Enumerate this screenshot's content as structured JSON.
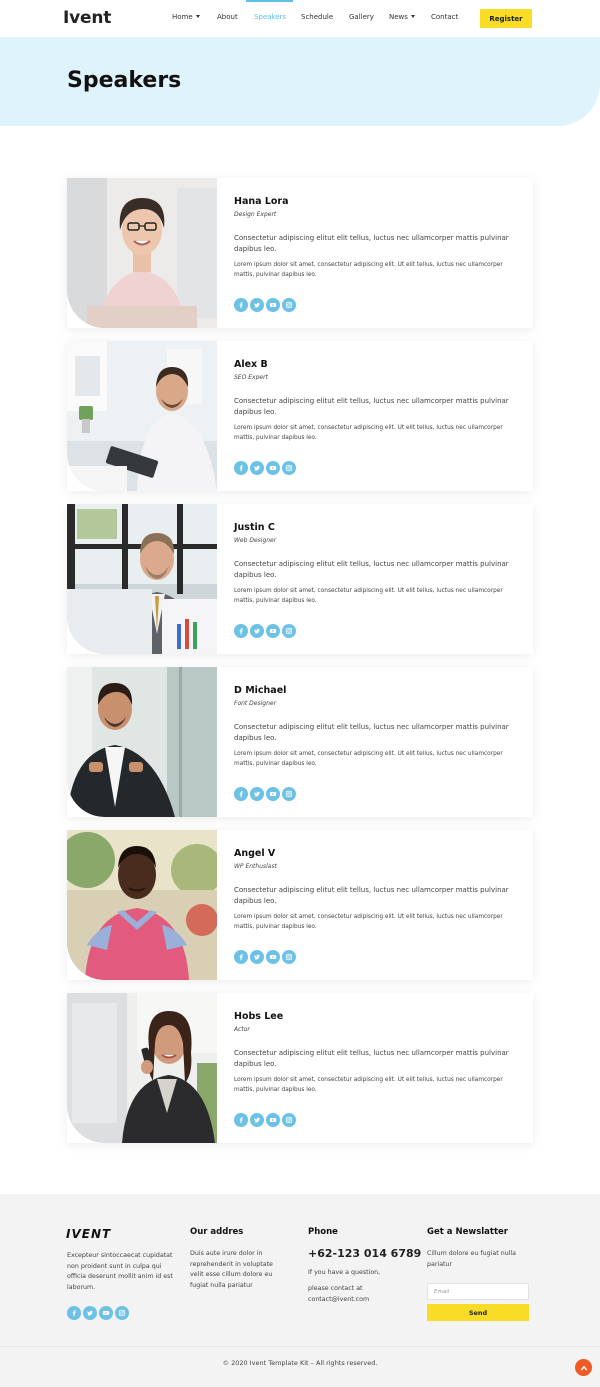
{
  "header": {
    "logo": "Ivent",
    "nav": [
      {
        "label": "Home",
        "dropdown": true,
        "active": false
      },
      {
        "label": "About",
        "dropdown": false,
        "active": false
      },
      {
        "label": "Speakers",
        "dropdown": false,
        "active": true
      },
      {
        "label": "Schedule",
        "dropdown": false,
        "active": false
      },
      {
        "label": "Gallery",
        "dropdown": false,
        "active": false
      },
      {
        "label": "News",
        "dropdown": true,
        "active": false
      },
      {
        "label": "Contact",
        "dropdown": false,
        "active": false
      }
    ],
    "register_label": "Register"
  },
  "hero": {
    "title": "Speakers"
  },
  "speakers": [
    {
      "name": "Hana Lora",
      "role": "Design Expert",
      "text1": "Consectetur adipiscing elitut elit tellus, luctus nec ullamcorper mattis pulvinar dapibus leo.",
      "text2": "Lorem ipsum dolor sit amet, consectetur adipiscing elit. Ut elit tellus, luctus nec ullamcorper mattis, pulvinar dapibus leo."
    },
    {
      "name": "Alex B",
      "role": "SEO Expert",
      "text1": "Consectetur adipiscing elitut elit tellus, luctus nec ullamcorper mattis pulvinar dapibus leo.",
      "text2": "Lorem ipsum dolor sit amet, consectetur adipiscing elit. Ut elit tellus, luctus nec ullamcorper mattis, pulvinar dapibus leo."
    },
    {
      "name": "Justin C",
      "role": "Web Designer",
      "text1": "Consectetur adipiscing elitut elit tellus, luctus nec ullamcorper mattis pulvinar dapibus leo.",
      "text2": "Lorem ipsum dolor sit amet, consectetur adipiscing elit. Ut elit tellus, luctus nec ullamcorper mattis, pulvinar dapibus leo."
    },
    {
      "name": "D Michael",
      "role": "Font Designer",
      "text1": "Consectetur adipiscing elitut elit tellus, luctus nec ullamcorper mattis pulvinar dapibus leo.",
      "text2": "Lorem ipsum dolor sit amet, consectetur adipiscing elit. Ut elit tellus, luctus nec ullamcorper mattis, pulvinar dapibus leo."
    },
    {
      "name": "Angel V",
      "role": "WP Enthuslast",
      "text1": "Consectetur adipiscing elitut elit tellus, luctus nec ullamcorper mattis pulvinar dapibus leo.",
      "text2": "Lorem ipsum dolor sit amet, consectetur adipiscing elit. Ut elit tellus, luctus nec ullamcorper mattis, pulvinar dapibus leo."
    },
    {
      "name": "Hobs Lee",
      "role": "Actor",
      "text1": "Consectetur adipiscing elitut elit tellus, luctus nec ullamcorper mattis pulvinar dapibus leo.",
      "text2": "Lorem ipsum dolor sit amet, consectetur adipiscing elit. Ut elit tellus, luctus nec ullamcorper mattis, pulvinar dapibus leo."
    }
  ],
  "social_icons": [
    "facebook-icon",
    "twitter-icon",
    "youtube-icon",
    "instagram-icon"
  ],
  "footer": {
    "logo": "IVENT",
    "about_text": "Excepteur sintoccaecat cupidatat non proident sunt in culpa qui officia deserunt mollit anim id est laborum.",
    "address_title": "Our addres",
    "address_text": "Duis aute irure dolor in reprehenderit in voluptate velit esse cillum dolore eu fugiat nulla pariatur",
    "phone_title": "Phone",
    "phone_number": "+62-123 014 6789",
    "phone_text1": "If you have a question,",
    "phone_text2": "please contact at contact@ivent.com",
    "newsletter_title": "Get a Newslatter",
    "newsletter_text": "Cillum dolore eu fugiat nulla pariatur",
    "email_placeholder": "Email",
    "send_label": "Send",
    "copyright": "© 2020 Ivent Template Kit – All rights reserved."
  },
  "colors": {
    "accent": "#5ec0e6",
    "social": "#6cc1e5",
    "register": "#f8dc26",
    "hero_bg": "#dff3fd",
    "back_to_top": "#f15a24"
  }
}
